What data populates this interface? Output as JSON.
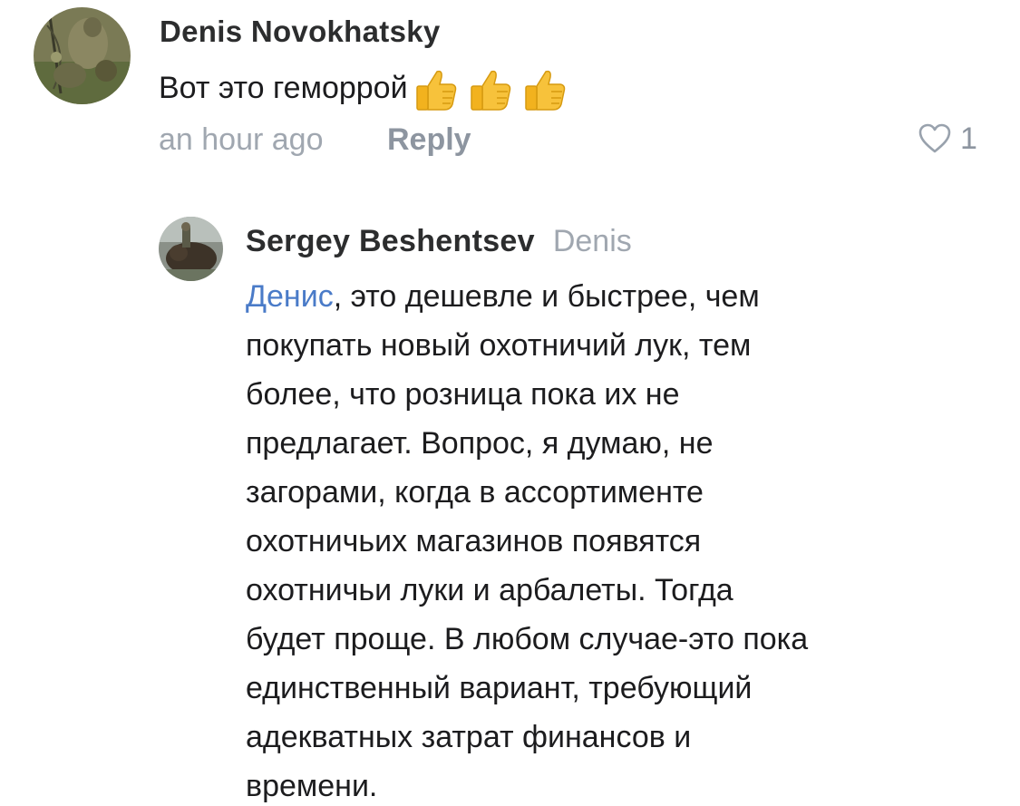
{
  "comment": {
    "author": "Denis Novokhatsky",
    "text": "Вот это геморрой",
    "emojis": [
      "thumbs-up",
      "thumbs-up",
      "thumbs-up"
    ],
    "time": "an hour ago",
    "reply_label": "Reply",
    "like_count": "1"
  },
  "reply": {
    "author": "Sergey Beshentsev",
    "reply_to": "Denis",
    "mention": "Денис",
    "lines": [
      ", это дешевле и быстрее, чем",
      "покупать новый охотничий лук, тем",
      "более, что розница пока их не",
      "предлагает. Вопрос, я думаю, не",
      "загорами, когда в ассортименте",
      "охотничьих магазинов появятся",
      "охотничьи луки и арбалеты. Тогда",
      "будет проще. В любом случае-это пока",
      "единственный вариант, требующий",
      "адекватных затрат финансов и",
      "времени."
    ]
  },
  "colors": {
    "mention": "#4a7bc8",
    "meta": "#8d95a0",
    "text": "#1c1c1e"
  }
}
